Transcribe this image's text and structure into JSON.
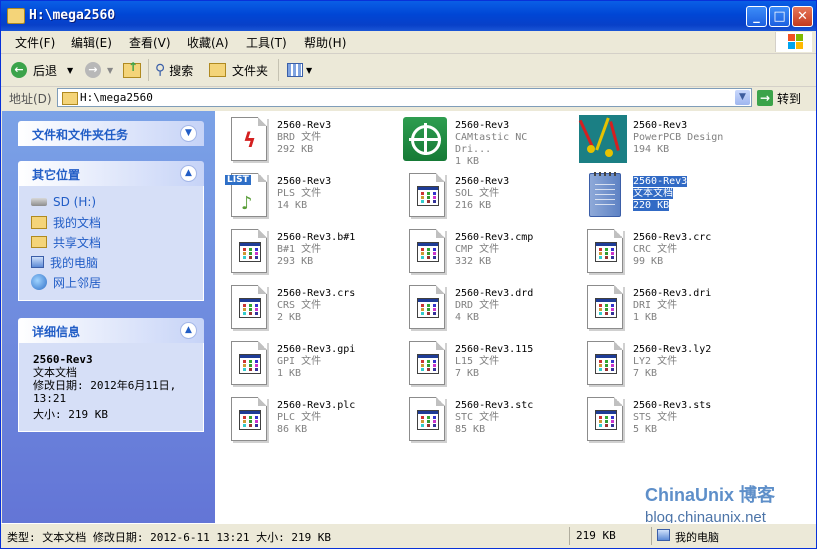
{
  "window": {
    "title": "H:\\mega2560"
  },
  "menu": [
    "文件(F)",
    "编辑(E)",
    "查看(V)",
    "收藏(A)",
    "工具(T)",
    "帮助(H)"
  ],
  "toolbar": {
    "back": "后退",
    "search": "搜索",
    "folders": "文件夹"
  },
  "address": {
    "label": "地址(D)",
    "value": "H:\\mega2560",
    "go": "转到"
  },
  "sidebar": {
    "tasks_title": "文件和文件夹任务",
    "other_title": "其它位置",
    "other_items": [
      "SD (H:)",
      "我的文档",
      "共享文档",
      "我的电脑",
      "网上邻居"
    ],
    "details_title": "详细信息",
    "details": {
      "name": "2560-Rev3",
      "type": "文本文档",
      "modified": "修改日期: 2012年6月11日, 13:21",
      "size": "大小: 219 KB"
    }
  },
  "files": [
    {
      "name": "2560-Rev3",
      "type": "BRD 文件",
      "size": "292 KB",
      "icon": "brd-icon"
    },
    {
      "name": "2560-Rev3",
      "type": "CAMtastic NC Dri...",
      "size": "1 KB",
      "icon": "camtastic-icon"
    },
    {
      "name": "2560-Rev3",
      "type": "PowerPCB Design",
      "size": "194 KB",
      "icon": "powerpcb-icon"
    },
    {
      "name": "2560-Rev3",
      "type": "PLS 文件",
      "size": "14 KB",
      "icon": "playlist-icon"
    },
    {
      "name": "2560-Rev3",
      "type": "SOL 文件",
      "size": "216 KB",
      "icon": "generic-file-icon"
    },
    {
      "name": "2560-Rev3",
      "type": "文本文档",
      "size": "220 KB",
      "icon": "notepad-icon",
      "selected": true
    },
    {
      "name": "2560-Rev3.b#1",
      "type": "B#1 文件",
      "size": "293 KB",
      "icon": "generic-file-icon"
    },
    {
      "name": "2560-Rev3.cmp",
      "type": "CMP 文件",
      "size": "332 KB",
      "icon": "generic-file-icon"
    },
    {
      "name": "2560-Rev3.crc",
      "type": "CRC 文件",
      "size": "99 KB",
      "icon": "generic-file-icon"
    },
    {
      "name": "2560-Rev3.crs",
      "type": "CRS 文件",
      "size": "2 KB",
      "icon": "generic-file-icon"
    },
    {
      "name": "2560-Rev3.drd",
      "type": "DRD 文件",
      "size": "4 KB",
      "icon": "generic-file-icon"
    },
    {
      "name": "2560-Rev3.dri",
      "type": "DRI 文件",
      "size": "1 KB",
      "icon": "generic-file-icon"
    },
    {
      "name": "2560-Rev3.gpi",
      "type": "GPI 文件",
      "size": "1 KB",
      "icon": "generic-file-icon"
    },
    {
      "name": "2560-Rev3.115",
      "type": "L15 文件",
      "size": "7 KB",
      "icon": "generic-file-icon"
    },
    {
      "name": "2560-Rev3.ly2",
      "type": "LY2 文件",
      "size": "7 KB",
      "icon": "generic-file-icon"
    },
    {
      "name": "2560-Rev3.plc",
      "type": "PLC 文件",
      "size": "86 KB",
      "icon": "generic-file-icon"
    },
    {
      "name": "2560-Rev3.stc",
      "type": "STC 文件",
      "size": "85 KB",
      "icon": "generic-file-icon"
    },
    {
      "name": "2560-Rev3.sts",
      "type": "STS 文件",
      "size": "5 KB",
      "icon": "generic-file-icon"
    }
  ],
  "status": {
    "info": "类型: 文本文档 修改日期: 2012-6-11 13:21 大小: 219 KB",
    "size": "219 KB",
    "location": "我的电脑"
  },
  "watermark": {
    "brand": "ChinaUnix 博客",
    "url": "blog.chinaunix.net"
  }
}
